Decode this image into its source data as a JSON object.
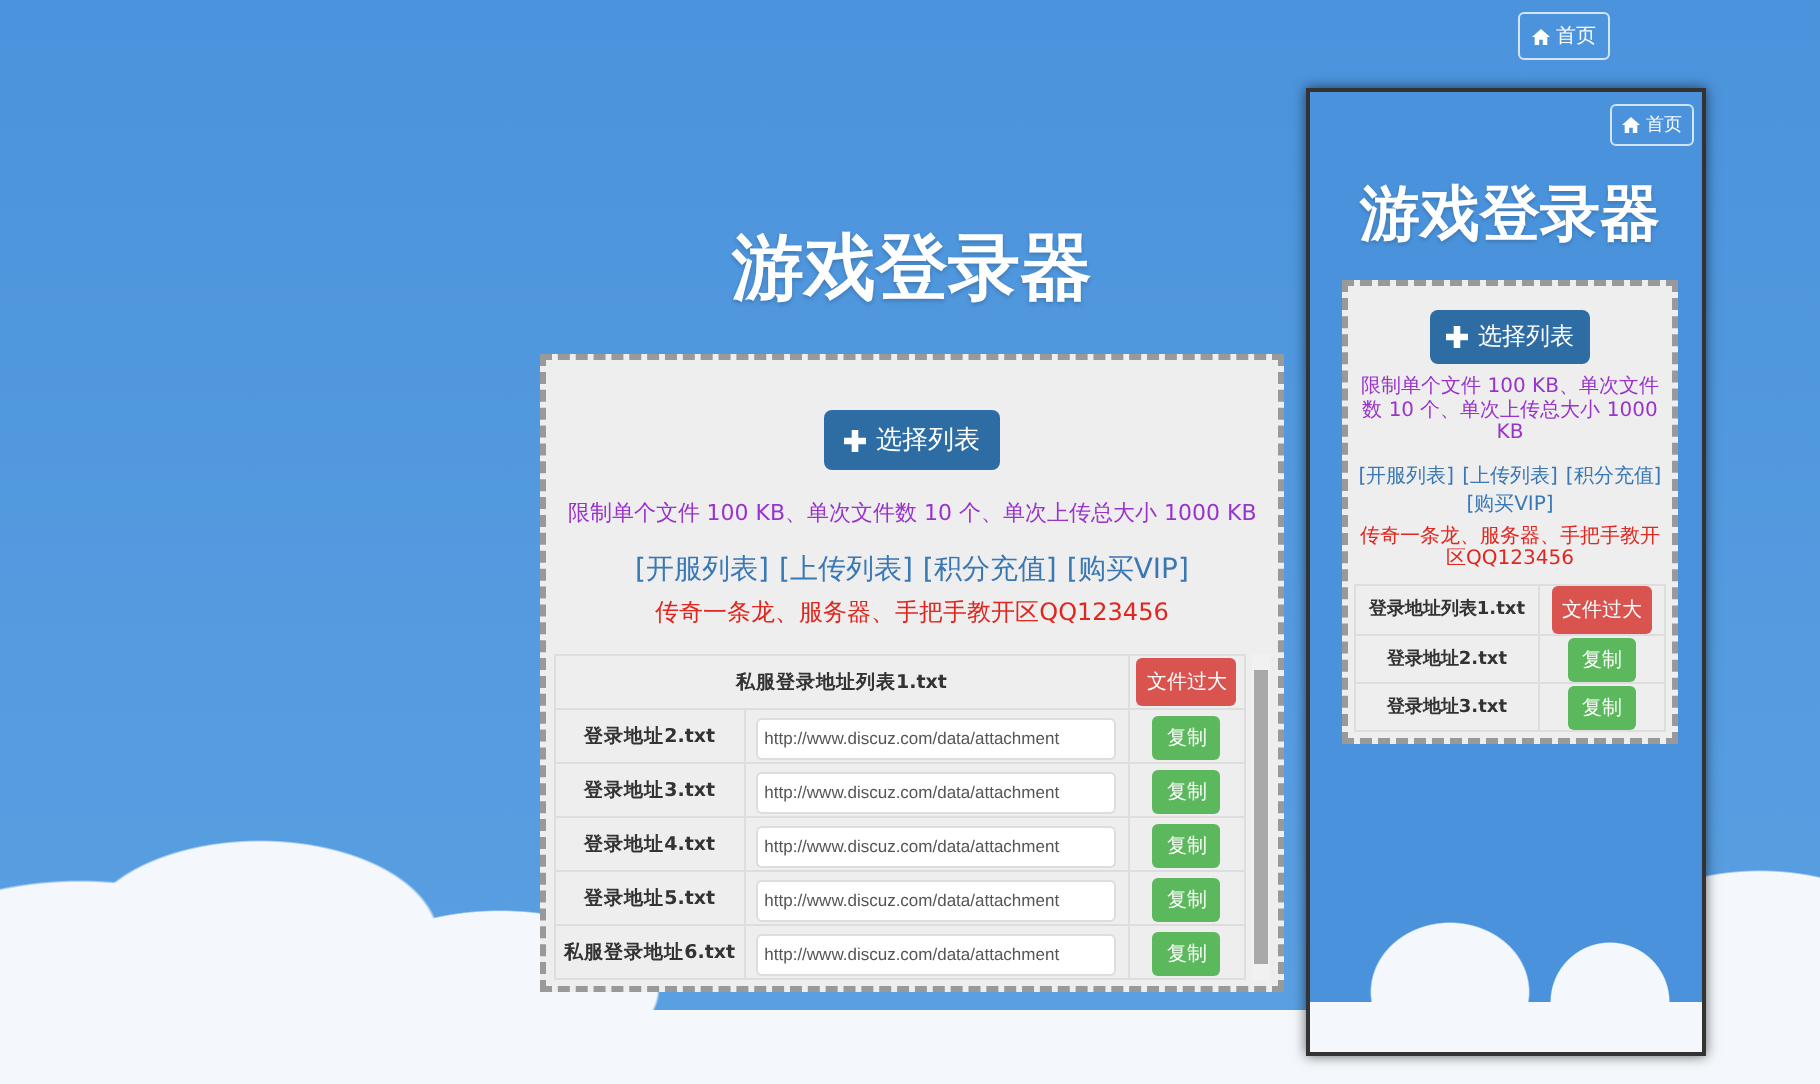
{
  "home_button": {
    "label": "首页"
  },
  "desktop": {
    "title": "游戏登录器",
    "select_button": {
      "label": "选择列表"
    },
    "limit_text": "限制单个文件 100 KB、单次文件数 10 个、单次上传总大小 1000 KB",
    "links": [
      "[开服列表]",
      "[上传列表]",
      "[积分充值]",
      "[购买VIP]"
    ],
    "notice": "传奇一条龙、服务器、手把手教开区QQ123456",
    "files": [
      {
        "name": "私服登录地址列表1.txt",
        "kind": "error",
        "action": "文件过大"
      },
      {
        "name": "登录地址2.txt",
        "kind": "ok",
        "url": "http://www.discuz.com/data/attachment",
        "action": "复制"
      },
      {
        "name": "登录地址3.txt",
        "kind": "ok",
        "url": "http://www.discuz.com/data/attachment",
        "action": "复制"
      },
      {
        "name": "登录地址4.txt",
        "kind": "ok",
        "url": "http://www.discuz.com/data/attachment",
        "action": "复制"
      },
      {
        "name": "登录地址5.txt",
        "kind": "ok",
        "url": "http://www.discuz.com/data/attachment",
        "action": "复制"
      },
      {
        "name": "私服登录地址6.txt",
        "kind": "ok",
        "url": "http://www.discuz.com/data/attachment",
        "action": "复制"
      }
    ]
  },
  "mobile": {
    "home_button": {
      "label": "首页"
    },
    "title": "游戏登录器",
    "select_button": {
      "label": "选择列表"
    },
    "limit_text": "限制单个文件 100 KB、单次文件数 10 个、单次上传总大小 1000 KB",
    "links": [
      "[开服列表]",
      "[上传列表]",
      "[积分充值]",
      "[购买VIP]"
    ],
    "notice": "传奇一条龙、服务器、手把手教开区QQ123456",
    "files": [
      {
        "name": "登录地址列表1.txt",
        "kind": "error",
        "action": "文件过大"
      },
      {
        "name": "登录地址2.txt",
        "kind": "ok",
        "action": "复制"
      },
      {
        "name": "登录地址3.txt",
        "kind": "ok",
        "action": "复制"
      }
    ]
  }
}
